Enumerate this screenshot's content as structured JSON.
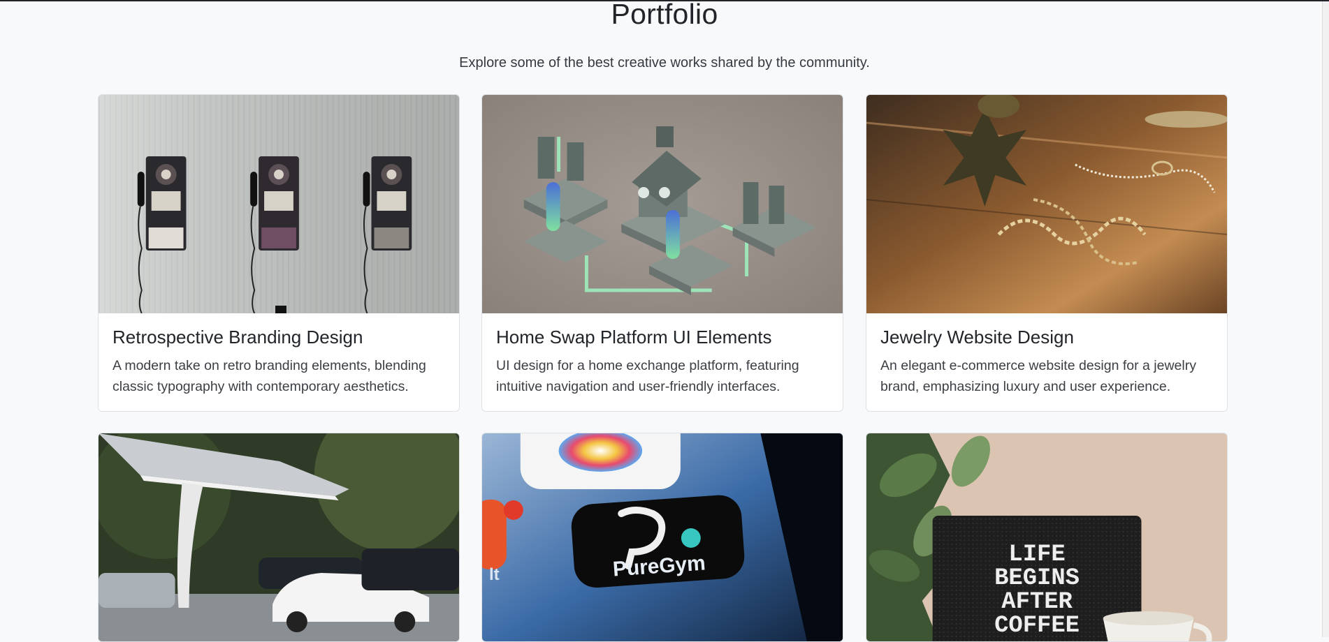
{
  "header": {
    "title": "Portfolio",
    "subtitle": "Explore some of the best creative works shared by the community."
  },
  "cards": [
    {
      "title": "Retrospective Branding Design",
      "description": "A modern take on retro branding elements, blending classic typography with contemporary aesthetics.",
      "image": "payphones-on-wall"
    },
    {
      "title": "Home Swap Platform UI Elements",
      "description": "UI design for a home exchange platform, featuring intuitive navigation and user-friendly interfaces.",
      "image": "isometric-house-illustration"
    },
    {
      "title": "Jewelry Website Design",
      "description": "An elegant e-commerce website design for a jewelry brand, emphasizing luxury and user experience.",
      "image": "gold-jewelry-on-table"
    },
    {
      "image": "ev-charging-station",
      "title": "",
      "description": ""
    },
    {
      "image": "puregym-app-icon",
      "caption": "PureGym",
      "title": "",
      "description": ""
    },
    {
      "image": "letterboard-sign",
      "caption_lines": [
        "LIFE",
        "BEGINS",
        "AFTER",
        "COFFEE"
      ],
      "title": "",
      "description": ""
    }
  ],
  "colors": {
    "background": "#f8f9fa",
    "card_border": "#dee2e6",
    "text": "#212529"
  }
}
